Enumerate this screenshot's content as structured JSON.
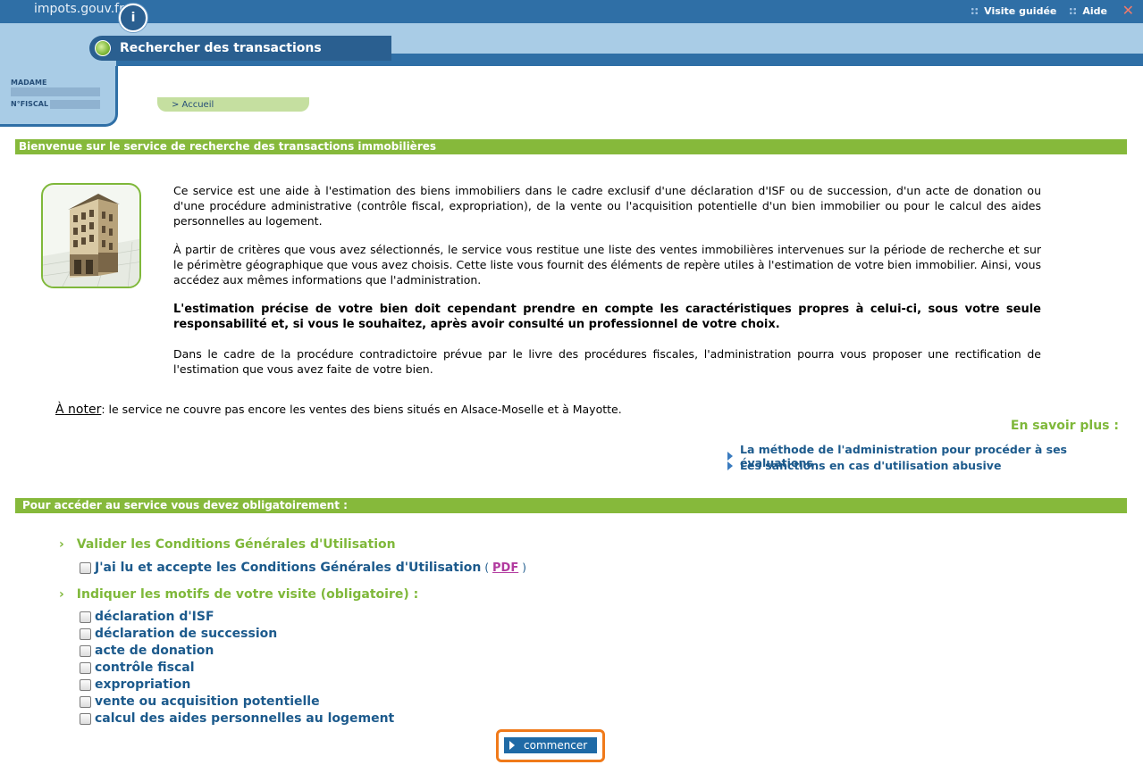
{
  "header": {
    "brand": "impots.gouv.fr",
    "brand_logo": "i",
    "links": [
      "Visite guidée",
      "Aide"
    ],
    "close": "✕",
    "service_title": "Rechercher des transactions immobilières"
  },
  "user": {
    "civility_label": "MADAME",
    "fiscal_label": "N°FISCAL :"
  },
  "breadcrumb": "> Accueil",
  "welcome": {
    "title": "Bienvenue sur le service de recherche des transactions immobilières",
    "p1": "Ce service est une aide à l'estimation des biens immobiliers dans le cadre exclusif d'une déclaration d'ISF ou de succession, d'un acte de donation ou d'une procédure administrative (contrôle fiscal, expropriation), de la vente ou l'acquisition potentielle d'un bien immobilier ou pour le calcul des aides personnelles au logement.",
    "p2": "À partir de critères que vous avez sélectionnés, le service vous restitue une liste des ventes immobilières intervenues sur la période de recherche et sur le périmètre géographique que vous avez choisis. Cette liste vous fournit des éléments de repère utiles à l'estimation de votre bien immobilier. Ainsi, vous accédez aux mêmes informations que l'administration.",
    "p3": "L'estimation précise de votre bien doit cependant prendre en compte les caractéristiques propres à celui-ci, sous votre seule responsabilité et, si vous le souhaitez, après avoir consulté un professionnel de votre choix.",
    "p4": "Dans le cadre de la procédure contradictoire prévue par le livre des procédures fiscales, l'administration pourra vous proposer une rectification de l'estimation que vous avez faite de votre bien.",
    "note_label": "À noter",
    "note_text": ": le service ne couvre pas encore les ventes des biens situés en Alsace-Moselle et à Mayotte.",
    "more_title": "En savoir plus :",
    "more_links": [
      "La méthode de l'administration pour procéder à ses évaluations",
      "Les sanctions en cas d'utilisation abusive"
    ]
  },
  "access": {
    "title": "Pour accéder au service vous devez obligatoirement :",
    "step1": "Valider les Conditions Générales d'Utilisation",
    "cgu_label": "J'ai lu et accepte les Conditions Générales d'Utilisation",
    "paren_open": "(",
    "pdf": "PDF",
    "paren_close": ")",
    "step2": "Indiquer les motifs de votre visite (obligatoire) :",
    "motives": [
      "déclaration d'ISF",
      "déclaration de succession",
      "acte de donation",
      "contrôle fiscal",
      "expropriation",
      "vente ou acquisition potentielle",
      "calcul des aides personnelles au logement"
    ],
    "start_button": "commencer"
  }
}
